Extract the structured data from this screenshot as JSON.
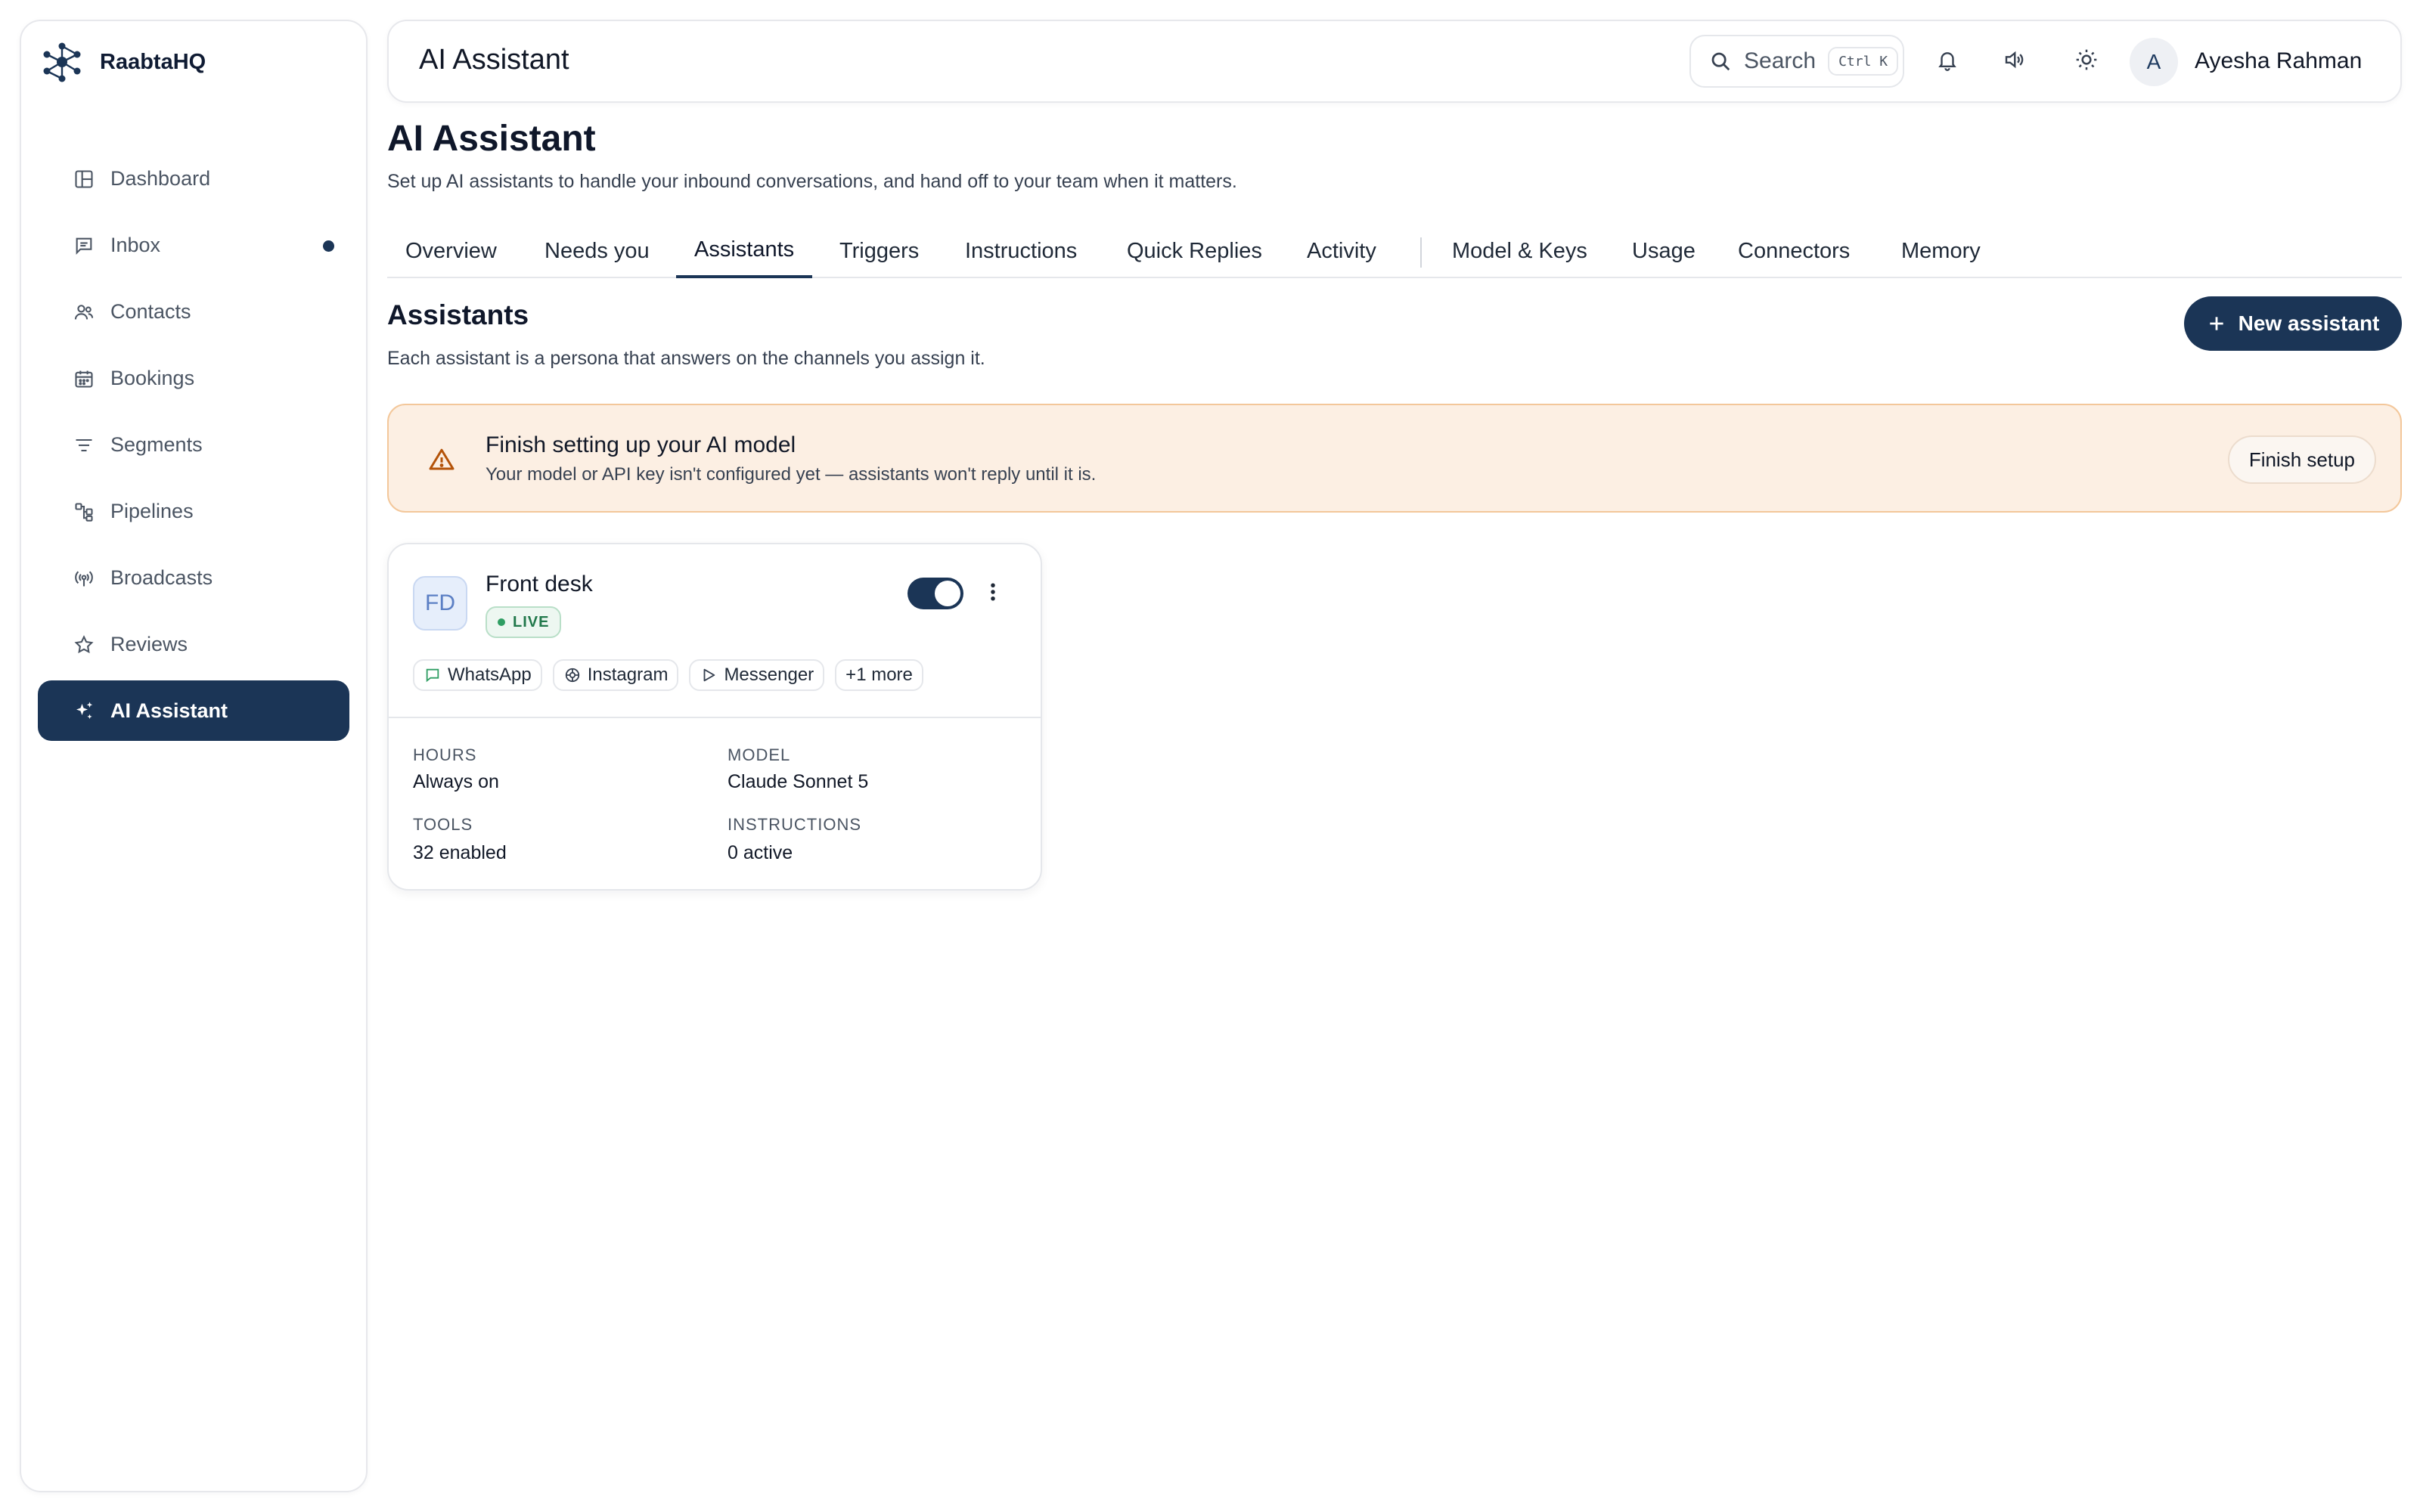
{
  "brand": {
    "name": "RaabtaHQ",
    "logo_icon": "network-logo-icon"
  },
  "sidebar": {
    "items": [
      {
        "label": "Dashboard",
        "icon": "layout-icon"
      },
      {
        "label": "Inbox",
        "icon": "message-icon",
        "has_dot": true
      },
      {
        "label": "Contacts",
        "icon": "users-icon"
      },
      {
        "label": "Bookings",
        "icon": "calendar-icon"
      },
      {
        "label": "Segments",
        "icon": "filter-icon"
      },
      {
        "label": "Pipelines",
        "icon": "pipeline-icon"
      },
      {
        "label": "Broadcasts",
        "icon": "broadcast-icon"
      },
      {
        "label": "Reviews",
        "icon": "star-icon"
      },
      {
        "label": "AI Assistant",
        "icon": "sparkles-icon",
        "active": true
      }
    ]
  },
  "header": {
    "title": "AI Assistant",
    "search": {
      "label": "Search",
      "shortcut": "Ctrl K"
    },
    "user": {
      "initial": "A",
      "name": "Ayesha Rahman"
    }
  },
  "page": {
    "title": "AI Assistant",
    "subtitle": "Set up AI assistants to handle your inbound conversations, and hand off to your team when it matters."
  },
  "tabs": [
    {
      "label": "Overview"
    },
    {
      "label": "Needs you"
    },
    {
      "label": "Assistants",
      "active": true
    },
    {
      "label": "Triggers"
    },
    {
      "label": "Instructions"
    },
    {
      "label": "Quick Replies"
    },
    {
      "label": "Activity"
    },
    {
      "label": "Model & Keys"
    },
    {
      "label": "Usage"
    },
    {
      "label": "Connectors"
    },
    {
      "label": "Memory"
    }
  ],
  "section": {
    "title": "Assistants",
    "subtitle": "Each assistant is a persona that answers on the channels you assign it.",
    "new_button": "New assistant"
  },
  "alert": {
    "title": "Finish setting up your AI model",
    "text": "Your model or API key isn't configured yet — assistants won't reply until it is.",
    "button": "Finish setup",
    "icon": "warning-triangle-icon",
    "color": "#fcefe3"
  },
  "assistant_card": {
    "initials": "FD",
    "name": "Front desk",
    "status": "LIVE",
    "enabled": true,
    "channels": [
      {
        "label": "WhatsApp",
        "icon": "chat-bubble-icon"
      },
      {
        "label": "Instagram",
        "icon": "instagram-icon"
      },
      {
        "label": "Messenger",
        "icon": "send-icon"
      },
      {
        "label": "+1 more",
        "icon": ""
      }
    ],
    "meta": {
      "hours_label": "HOURS",
      "hours_value": "Always on",
      "model_label": "MODEL",
      "model_value": "Claude Sonnet 5",
      "tools_label": "TOOLS",
      "tools_value": "32 enabled",
      "instructions_label": "INSTRUCTIONS",
      "instructions_value": "0 active"
    }
  },
  "colors": {
    "accent": "#1b3556",
    "live": "#21784b"
  }
}
